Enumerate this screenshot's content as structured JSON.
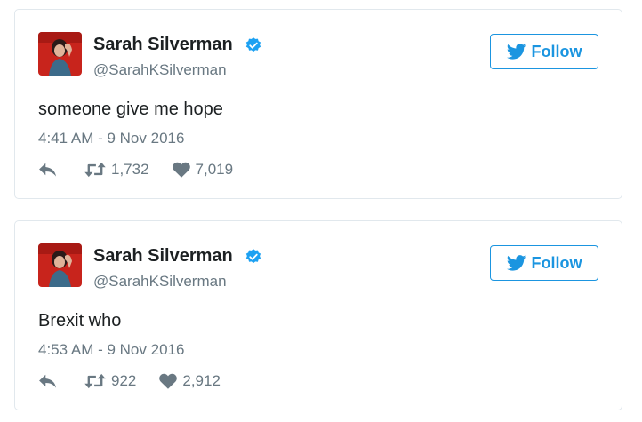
{
  "colors": {
    "accent": "#1b95e0",
    "secondary_text": "#697882",
    "border": "#e1e8ed"
  },
  "tweets": [
    {
      "author": {
        "name": "Sarah Silverman",
        "handle": "@SarahKSilverman",
        "verified": true,
        "avatar_icon": "profile-photo"
      },
      "follow_label": "Follow",
      "text": "someone give me hope",
      "timestamp": "4:41 AM - 9 Nov 2016",
      "reply_icon": "reply-icon",
      "retweets": "1,732",
      "likes": "7,019"
    },
    {
      "author": {
        "name": "Sarah Silverman",
        "handle": "@SarahKSilverman",
        "verified": true,
        "avatar_icon": "profile-photo"
      },
      "follow_label": "Follow",
      "text": "Brexit who",
      "timestamp": "4:53 AM - 9 Nov 2016",
      "reply_icon": "reply-icon",
      "retweets": "922",
      "likes": "2,912"
    }
  ]
}
